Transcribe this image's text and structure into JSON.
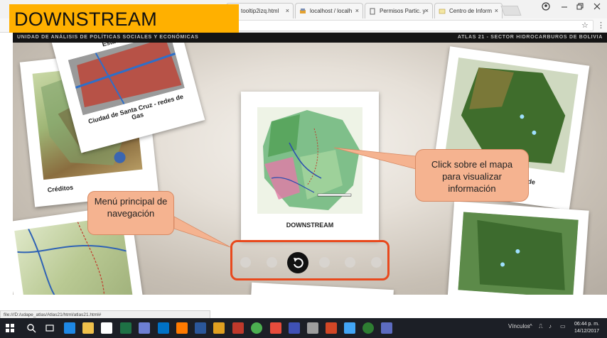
{
  "overlay_title": "DOWNSTREAM",
  "browser": {
    "tabs": [
      {
        "title": "tooltip2izq.html",
        "icon": "page-icon"
      },
      {
        "title": "localhost / localh",
        "icon": "phpmyadmin-icon"
      },
      {
        "title": "Permisos Partic. y",
        "icon": "document-icon"
      },
      {
        "title": "Centro de Inform",
        "icon": "page-icon"
      }
    ],
    "close_glyph": "×",
    "status_url": "file:///D:/udape_atlas/Atlas21/html/atlas21.html#"
  },
  "site": {
    "header_left": "UNIDAD DE ANÁLISIS DE POLÍTICAS SOCIALES Y ECONÓMICAS",
    "header_right": "ATLAS 21 - SECTOR HIDROCARBUROS DE BOLIVIA"
  },
  "cards": {
    "center": "DOWNSTREAM",
    "top_left": "Ciudad de Santa Cruz - redes de Gas",
    "top_left_partial": "Estac",
    "left": "Créditos",
    "right_partial": "de"
  },
  "callouts": {
    "map": "Click sobre el mapa para visualizar información",
    "menu": "Menú principal de navegación"
  },
  "nav": {
    "dots_total": 7,
    "active_index": 2,
    "active_icon": "undo-arrow-icon"
  },
  "taskbar": {
    "tray_label": "Vínculos",
    "time": "06:44 p. m.",
    "date": "14/12/2017"
  },
  "colors": {
    "badge": "#ffb000",
    "callout_fill": "#f5b390",
    "menu_frame": "#e8491d",
    "header_bar": "#141414"
  }
}
